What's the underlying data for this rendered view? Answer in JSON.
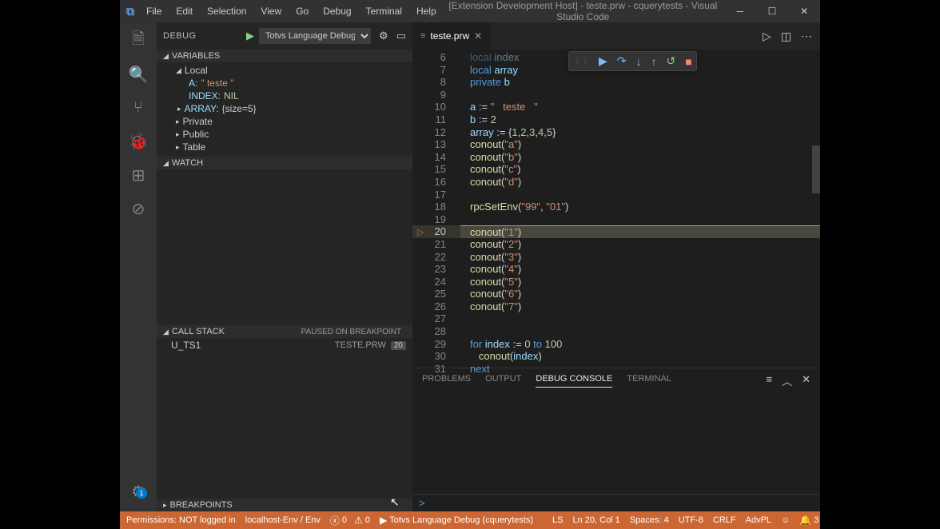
{
  "window": {
    "title": "[Extension Development Host] - teste.prw - cquerytests - Visual Studio Code"
  },
  "menubar": [
    "File",
    "Edit",
    "Selection",
    "View",
    "Go",
    "Debug",
    "Terminal",
    "Help"
  ],
  "debug_panel": {
    "title": "DEBUG",
    "config": "Totvs Language Debug",
    "sections": {
      "variables": "VARIABLES",
      "watch": "WATCH",
      "callstack": "CALL STACK",
      "callstack_status": "PAUSED ON BREAKPOINT",
      "breakpoints": "BREAKPOINTS"
    },
    "scopes": {
      "local": "Local",
      "private": "Private",
      "public": "Public",
      "table": "Table"
    },
    "local_vars": {
      "a_key": "A:",
      "a_val": "\"   teste   \"",
      "index_key": "INDEX:",
      "index_val": "NIL",
      "array_key": "ARRAY:",
      "array_val": "{size=5}"
    },
    "callstack_row": {
      "func": "U_TS1",
      "file": "TESTE.PRW",
      "line": "20"
    }
  },
  "tab": {
    "name": "teste.prw"
  },
  "code_lines": [
    {
      "n": "6",
      "html": "<span class='kw'>local</span> <span class='id'>index</span>",
      "faded": true
    },
    {
      "n": "7",
      "html": "<span class='kw'>local</span> <span class='id'>array</span>"
    },
    {
      "n": "8",
      "html": "<span class='kw'>private</span> <span class='id'>b</span>"
    },
    {
      "n": "9",
      "html": ""
    },
    {
      "n": "10",
      "html": "<span class='id'>a</span> := <span class='str'>\"   teste   \"</span>"
    },
    {
      "n": "11",
      "html": "<span class='id'>b</span> := <span class='num'>2</span>"
    },
    {
      "n": "12",
      "html": "<span class='id'>array</span> := {<span class='num'>1</span>,<span class='num'>2</span>,<span class='num'>3</span>,<span class='num'>4</span>,<span class='num'>5</span>}"
    },
    {
      "n": "13",
      "html": "<span class='fn'>conout</span>(<span class='str'>\"a\"</span>)"
    },
    {
      "n": "14",
      "html": "<span class='fn'>conout</span>(<span class='str'>\"b\"</span>)"
    },
    {
      "n": "15",
      "html": "<span class='fn'>conout</span>(<span class='str'>\"c\"</span>)"
    },
    {
      "n": "16",
      "html": "<span class='fn'>conout</span>(<span class='str'>\"d\"</span>)"
    },
    {
      "n": "17",
      "html": ""
    },
    {
      "n": "18",
      "html": "<span class='fn'>rpcSetEnv</span>(<span class='str'>\"99\"</span>, <span class='str'>\"01\"</span>)"
    },
    {
      "n": "19",
      "html": ""
    },
    {
      "n": "20",
      "html": "<span class='fn'>conout</span>(<span class='str'>\"1\"</span>)",
      "current": true
    },
    {
      "n": "21",
      "html": "<span class='fn'>conout</span>(<span class='str'>\"2\"</span>)"
    },
    {
      "n": "22",
      "html": "<span class='fn'>conout</span>(<span class='str'>\"3\"</span>)"
    },
    {
      "n": "23",
      "html": "<span class='fn'>conout</span>(<span class='str'>\"4\"</span>)"
    },
    {
      "n": "24",
      "html": "<span class='fn'>conout</span>(<span class='str'>\"5\"</span>)"
    },
    {
      "n": "25",
      "html": "<span class='fn'>conout</span>(<span class='str'>\"6\"</span>)"
    },
    {
      "n": "26",
      "html": "<span class='fn'>conout</span>(<span class='str'>\"7\"</span>)"
    },
    {
      "n": "27",
      "html": ""
    },
    {
      "n": "28",
      "html": ""
    },
    {
      "n": "29",
      "html": "<span class='kw'>for</span> <span class='id'>index</span> := <span class='num'>0</span> <span class='kw'>to</span> <span class='num'>100</span>"
    },
    {
      "n": "30",
      "html": "   <span class='fn'>conout</span>(<span class='id'>index</span>)"
    },
    {
      "n": "31",
      "html": "<span class='kw'>next</span>"
    }
  ],
  "panel_tabs": {
    "problems": "PROBLEMS",
    "output": "OUTPUT",
    "debug_console": "DEBUG CONSOLE",
    "terminal": "TERMINAL"
  },
  "panel_prompt": ">",
  "statusbar": {
    "permissions": "Permissions: NOT logged in",
    "server": "localhost-Env / Env",
    "errors": "0",
    "warnings": "0",
    "debug_target": "Totvs Language Debug (cquerytests)",
    "ls": "LS",
    "position": "Ln 20, Col 1",
    "spaces": "Spaces: 4",
    "encoding": "UTF-8",
    "eol": "CRLF",
    "lang": "AdvPL",
    "bell": "3"
  },
  "activity_badge": "1"
}
